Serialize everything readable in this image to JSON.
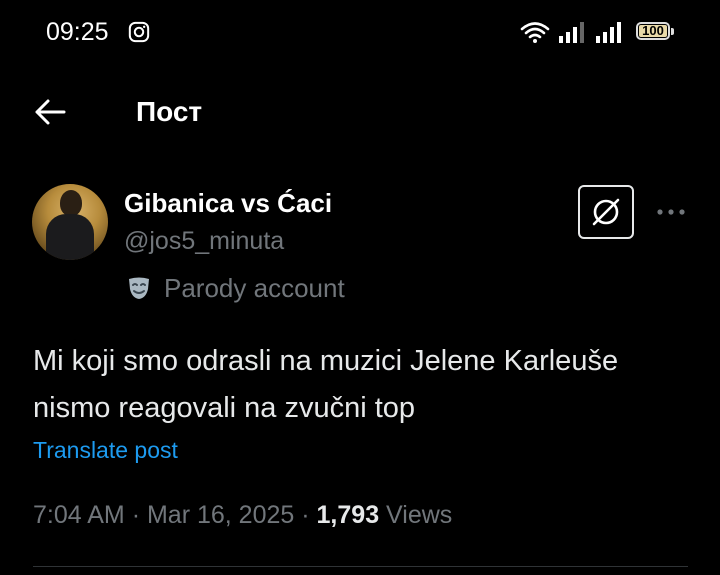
{
  "status_bar": {
    "time": "09:25",
    "battery_level": "100",
    "icons": [
      "instagram-icon",
      "wifi-icon",
      "signal-icon",
      "signal-icon",
      "battery-icon"
    ]
  },
  "nav": {
    "back_icon": "arrow-left-icon",
    "title": "Пост"
  },
  "post": {
    "author": {
      "display_name": "Gibanica vs Ćaci",
      "handle": "@jos5_minuta",
      "label": "Parody account",
      "label_icon": "theater-mask-icon"
    },
    "text": "Mi koji smo odrasli na muzici Jelene Karleuše nismo reagovali na zvučni top",
    "translate_label": "Translate post",
    "time": "7:04 AM",
    "date": "Mar 16, 2025",
    "views_count": "1,793",
    "views_label": "Views",
    "separator": "·"
  },
  "colors": {
    "background": "#000000",
    "text_primary": "#e7e9ea",
    "text_secondary": "#71767b",
    "accent": "#1d9bf0"
  }
}
